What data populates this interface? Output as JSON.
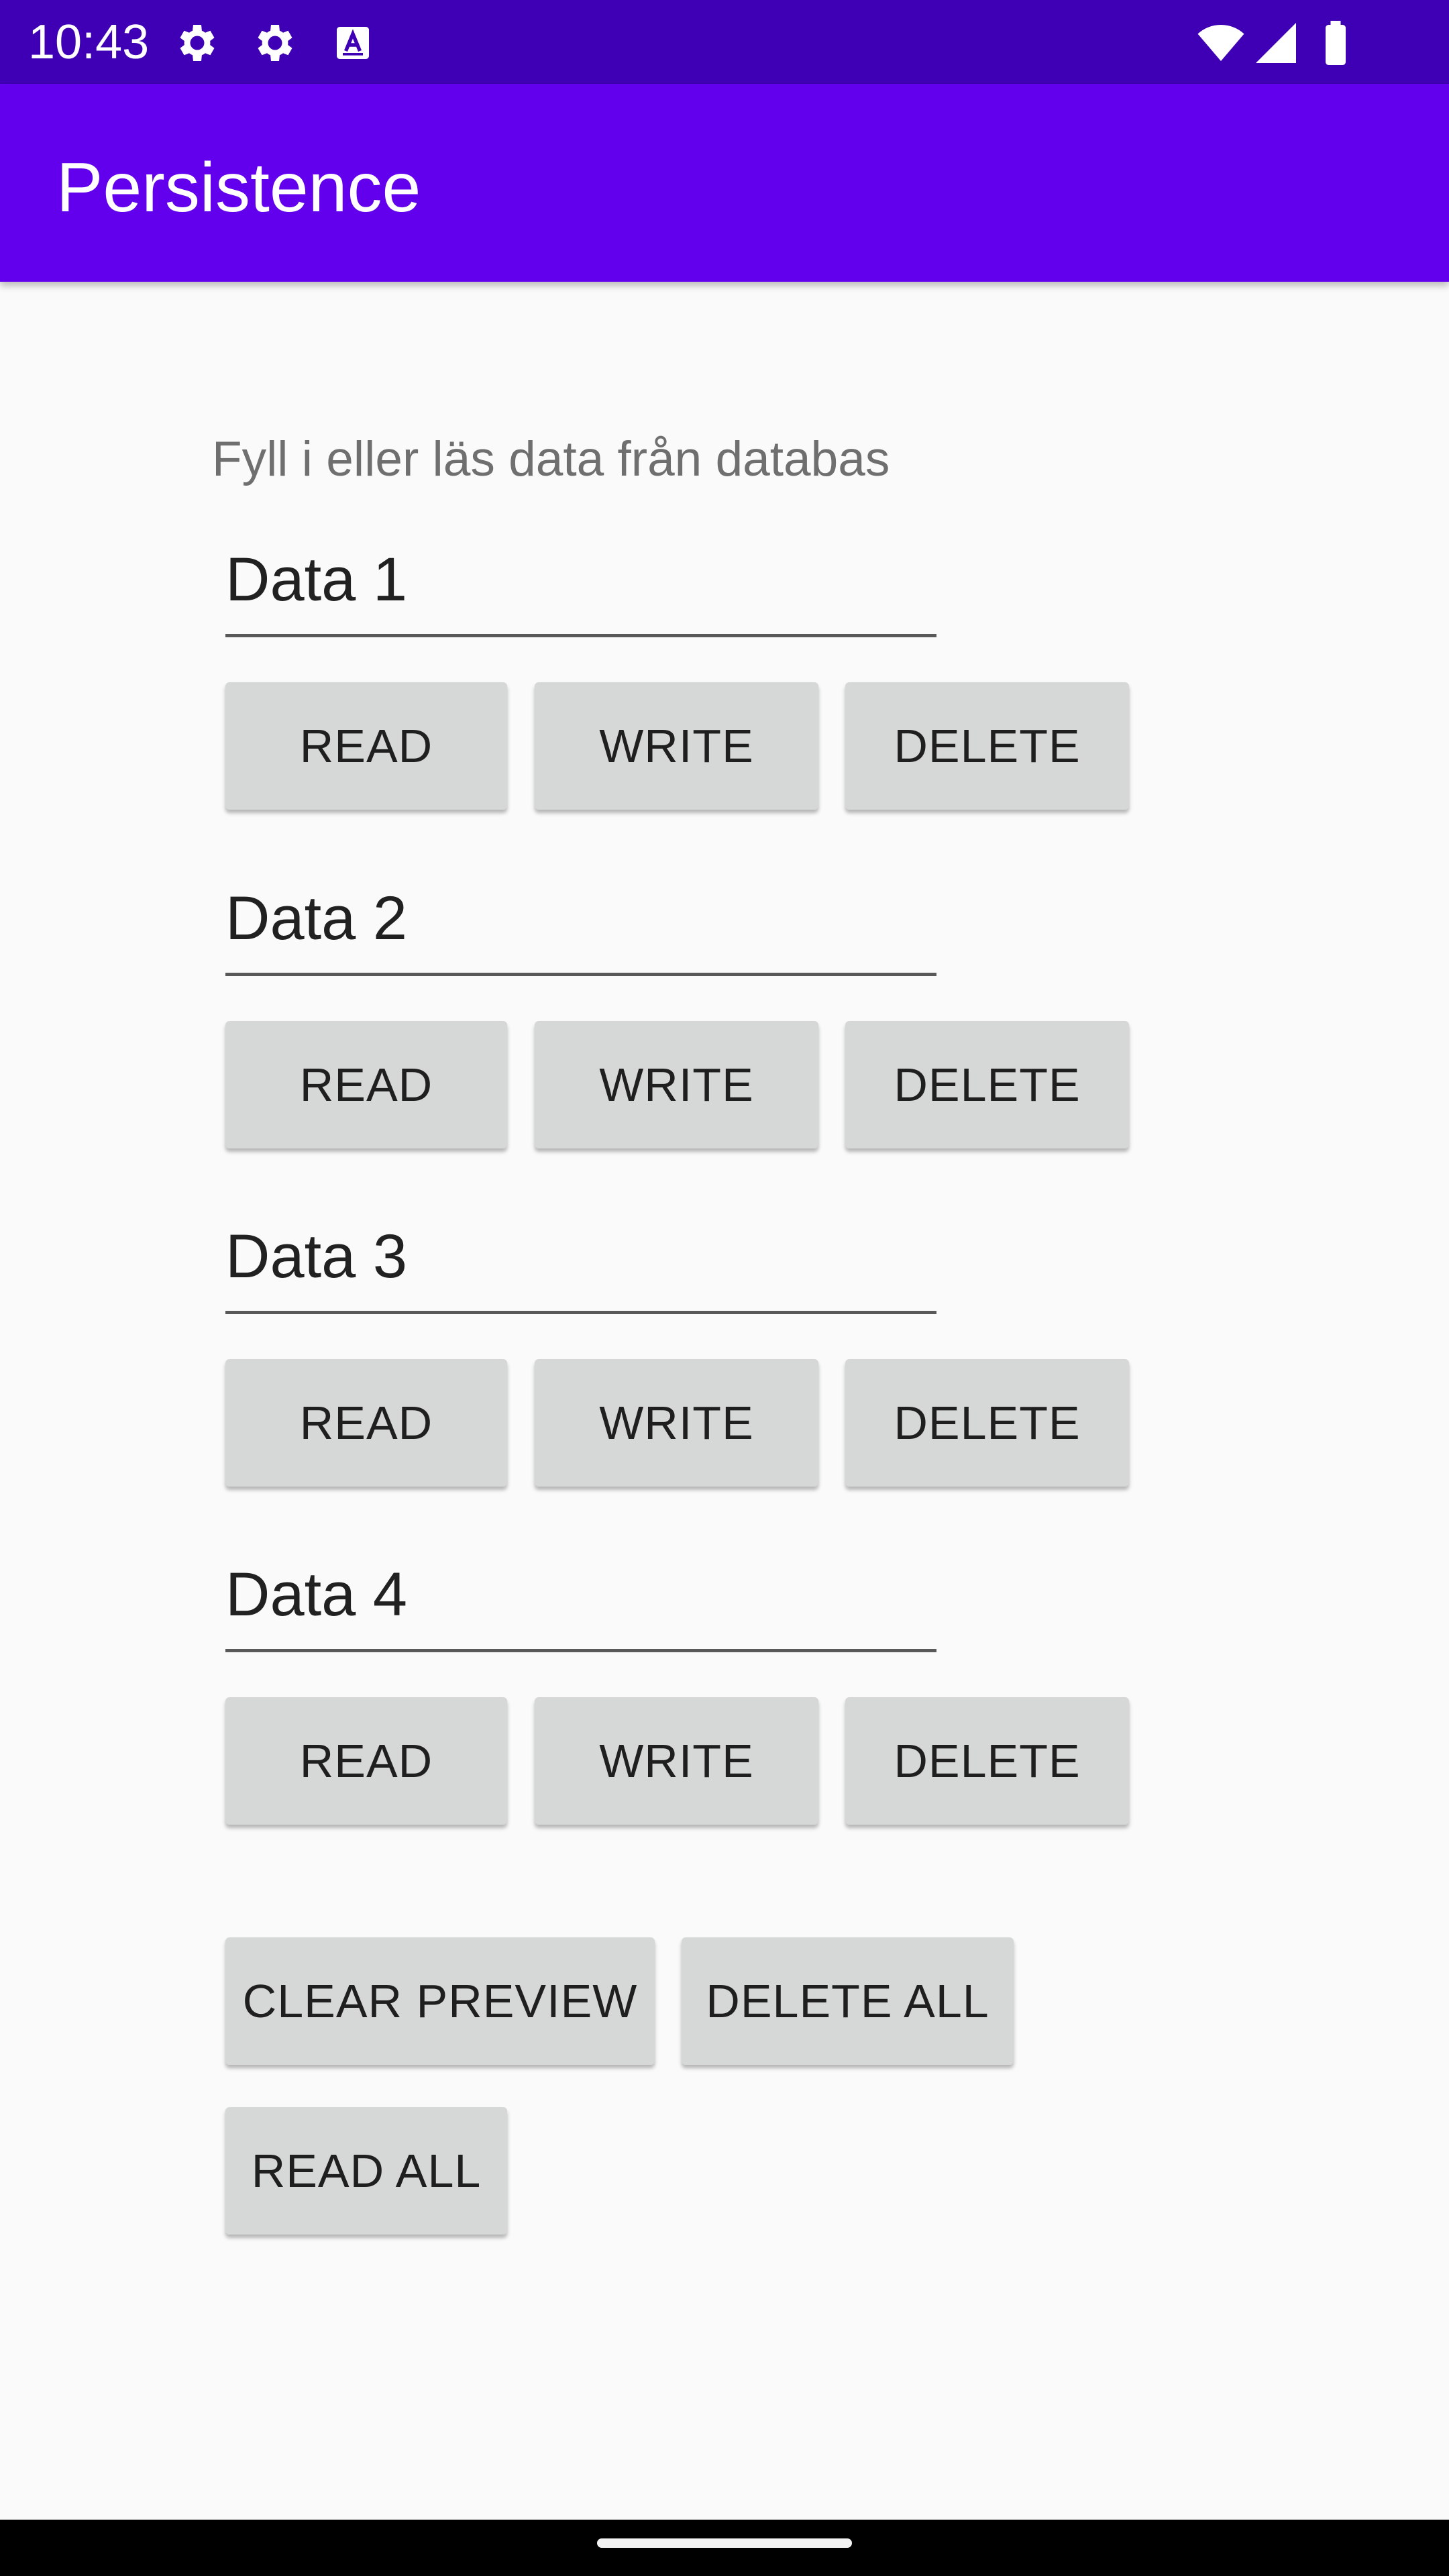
{
  "status_bar": {
    "time": "10:43",
    "left_icons": [
      "gear-icon",
      "gear-icon",
      "text-a-icon"
    ],
    "right_icons": [
      "wifi-icon",
      "signal-icon",
      "battery-icon"
    ],
    "background": "#3f00b5"
  },
  "app_bar": {
    "title": "Persistence",
    "background": "#6200ee"
  },
  "content": {
    "instruction": "Fyll i eller läs data från databas",
    "rows": [
      {
        "value": "Data 1",
        "read": "READ",
        "write": "WRITE",
        "delete": "DELETE"
      },
      {
        "value": "Data 2",
        "read": "READ",
        "write": "WRITE",
        "delete": "DELETE"
      },
      {
        "value": "Data 3",
        "read": "READ",
        "write": "WRITE",
        "delete": "DELETE"
      },
      {
        "value": "Data 4",
        "read": "READ",
        "write": "WRITE",
        "delete": "DELETE"
      }
    ],
    "clear_preview": "CLEAR PREVIEW",
    "delete_all": "DELETE ALL",
    "read_all": "READ ALL"
  }
}
